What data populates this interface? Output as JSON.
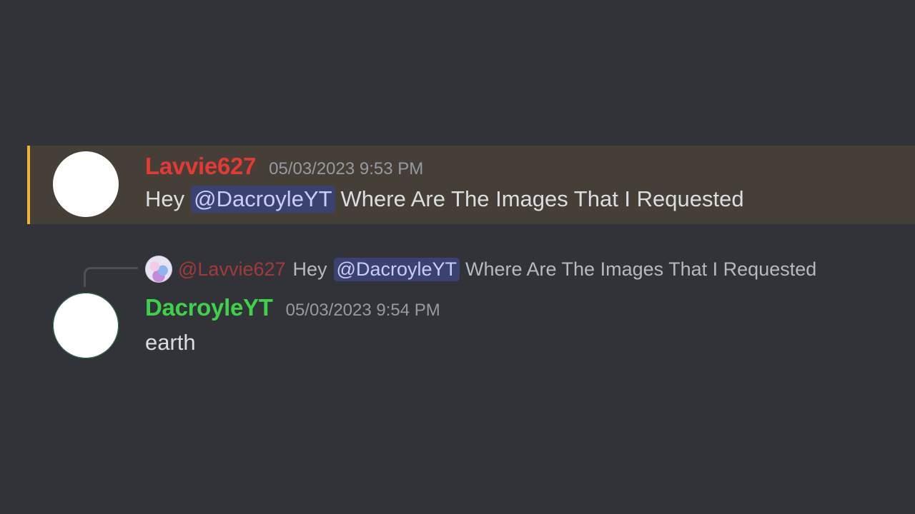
{
  "colors": {
    "background": "#313338",
    "highlight_background": "#453f37",
    "highlight_bar": "#f0b232",
    "mention_background": "#3c4270",
    "mention_text": "#c9cdfb"
  },
  "messages": [
    {
      "username": "Lavvie627",
      "username_color": "#e53935",
      "timestamp": "05/03/2023 9:53 PM",
      "content_before": "Hey",
      "mention": "@DacroyleYT",
      "content_after": "Where Are The Images That I Requested",
      "highlighted": true
    },
    {
      "reply": {
        "username": "@Lavvie627",
        "content_before": "Hey",
        "mention": "@DacroyleYT",
        "content_after": "Where Are The Images That I Requested"
      },
      "username": "DacroyleYT",
      "username_color": "#3ed14a",
      "timestamp": "05/03/2023 9:54 PM",
      "content": "earth"
    }
  ]
}
